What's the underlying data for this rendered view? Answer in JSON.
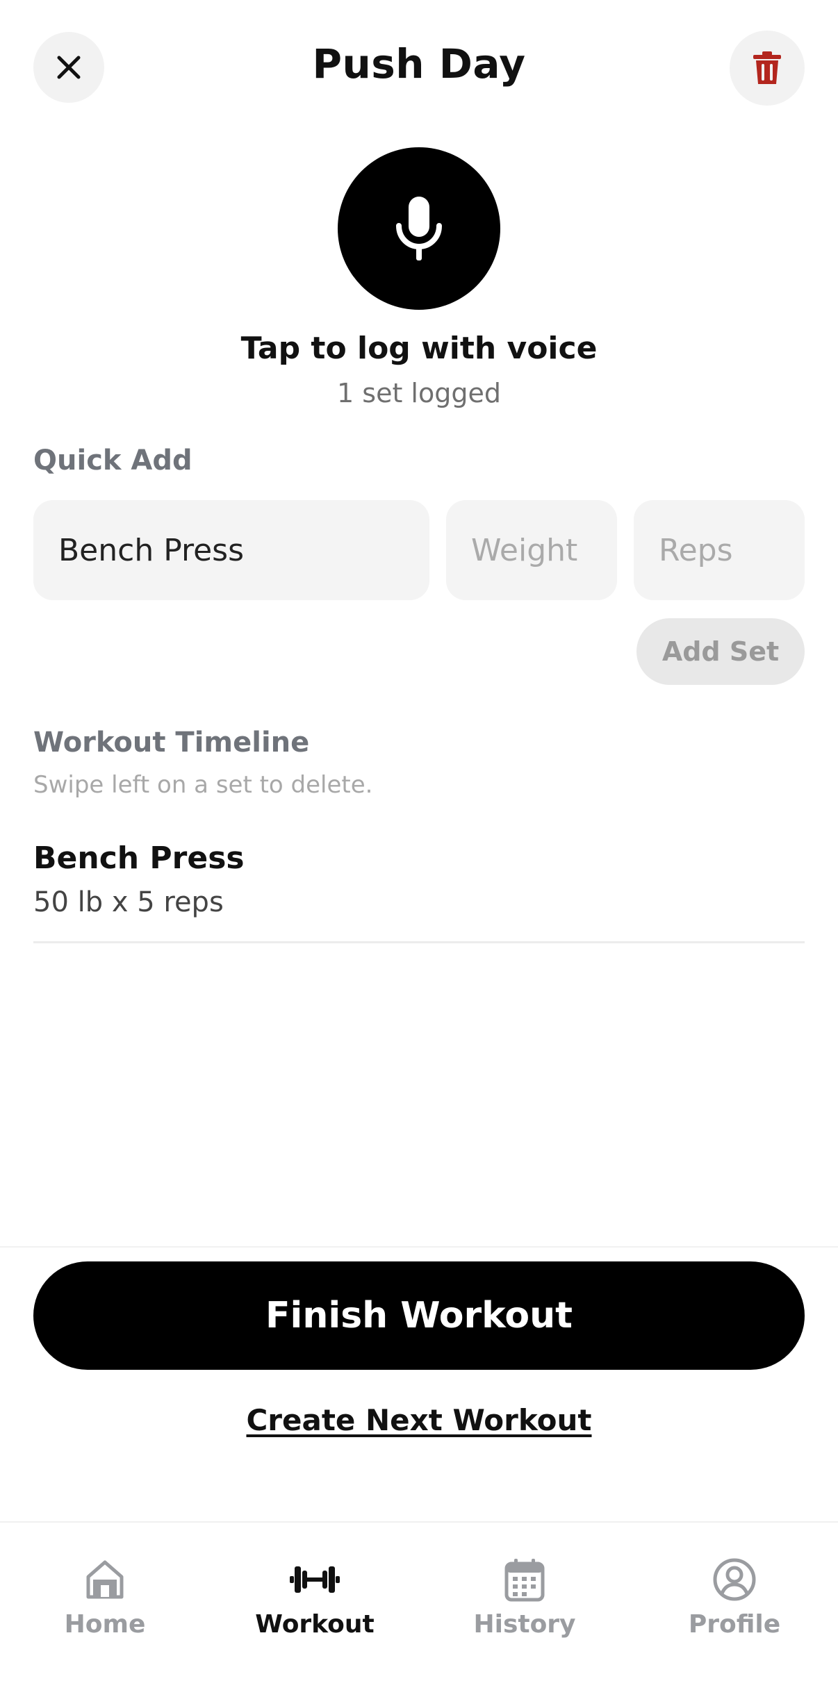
{
  "header": {
    "title": "Push Day",
    "close_icon": "close-icon",
    "delete_icon": "trash-icon",
    "delete_color": "#b3261e"
  },
  "voice": {
    "icon": "microphone-icon",
    "title": "Tap to log with voice",
    "status": "1 set logged"
  },
  "quick_add": {
    "label": "Quick Add",
    "exercise_value": "Bench Press",
    "weight_placeholder": "Weight",
    "reps_placeholder": "Reps",
    "add_button": "Add Set"
  },
  "timeline": {
    "label": "Workout Timeline",
    "hint": "Swipe left on a set to delete.",
    "sets": [
      {
        "exercise": "Bench Press",
        "detail": "50 lb x 5 reps"
      }
    ]
  },
  "actions": {
    "finish": "Finish Workout",
    "next": "Create Next Workout"
  },
  "tabbar": {
    "tabs": [
      {
        "label": "Home",
        "icon": "home-icon",
        "active": false
      },
      {
        "label": "Workout",
        "icon": "dumbbell-icon",
        "active": true
      },
      {
        "label": "History",
        "icon": "calendar-icon",
        "active": false
      },
      {
        "label": "Profile",
        "icon": "profile-icon",
        "active": false
      }
    ]
  },
  "colors": {
    "primary": "#000000",
    "muted_label": "#6f737a",
    "inactive_tab": "#9a9ca0"
  }
}
